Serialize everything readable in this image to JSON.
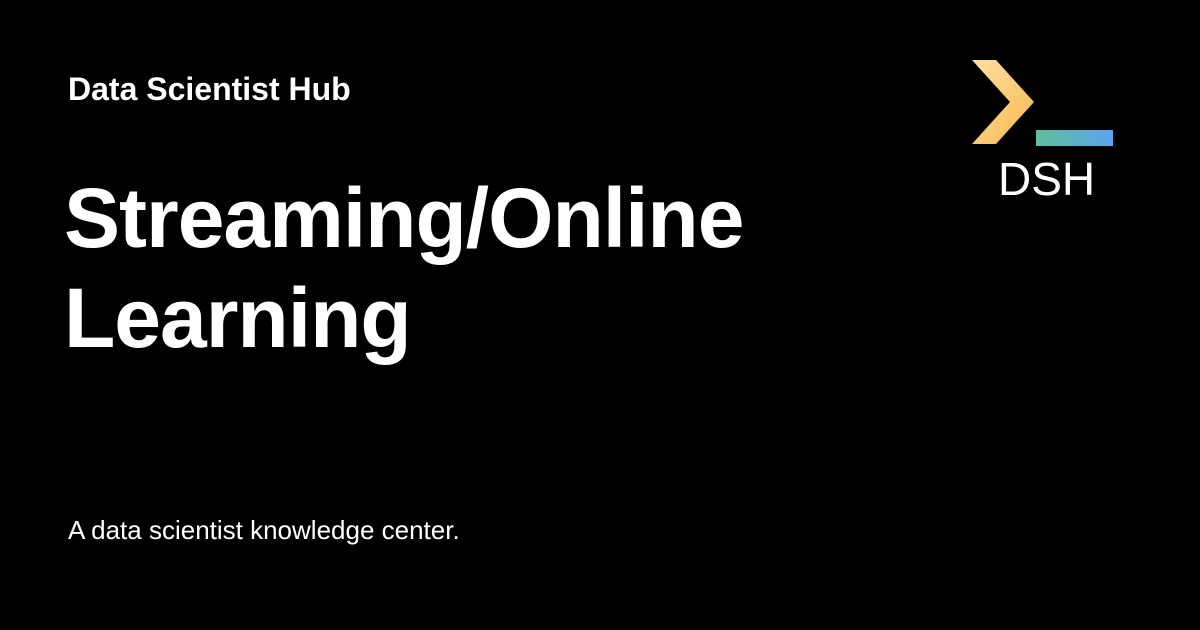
{
  "header": {
    "site_name": "Data Scientist Hub"
  },
  "main": {
    "title": "Streaming/Online Learning",
    "tagline": "A data scientist knowledge center."
  },
  "logo": {
    "text": "DSH",
    "chevron_colors": [
      "#f6c26a",
      "#ffe0a3"
    ],
    "underscore_colors": [
      "#5fbf9a",
      "#5aa4ef"
    ]
  }
}
